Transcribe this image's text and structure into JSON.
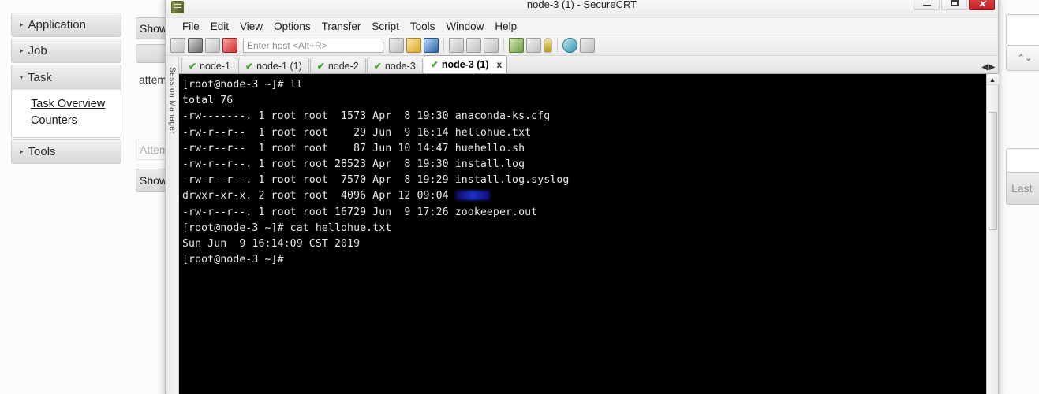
{
  "background_page": {
    "sidebar": {
      "sections": [
        {
          "label": "Application",
          "expanded": false,
          "arrow": "▸"
        },
        {
          "label": "Job",
          "expanded": false,
          "arrow": "▸"
        },
        {
          "label": "Task",
          "expanded": true,
          "arrow": "▾",
          "links": [
            "Task Overview",
            "Counters"
          ]
        },
        {
          "label": "Tools",
          "expanded": false,
          "arrow": "▸"
        }
      ]
    },
    "clipped_left_widgets": [
      {
        "label": "Show",
        "kind": "button"
      },
      {
        "label": "",
        "kind": "button"
      },
      {
        "label": "attem",
        "kind": "text"
      },
      {
        "label": "Attem",
        "kind": "ghost"
      },
      {
        "label": "Show",
        "kind": "button"
      }
    ],
    "clipped_right_widgets": [
      {
        "label": "",
        "kind": "input"
      },
      {
        "label": "⌃⌄",
        "kind": "spinner"
      },
      {
        "label": "",
        "kind": "input"
      },
      {
        "label": "Last",
        "kind": "button"
      }
    ]
  },
  "securecrt": {
    "title": "node-3 (1) - SecureCRT",
    "app_icon": "securecrt-icon",
    "window_controls": {
      "minimize": "–",
      "maximize": "❑",
      "close": "✕"
    },
    "menu": [
      "File",
      "Edit",
      "View",
      "Options",
      "Transfer",
      "Script",
      "Tools",
      "Window",
      "Help"
    ],
    "toolbar": {
      "host_input_placeholder": "Enter host <Alt+R>",
      "host_input_value": "",
      "icons": [
        "session-manager-icon",
        "connect-icon",
        "connect-sftp-icon",
        "disconnect-icon",
        "copy-icon",
        "paste-icon",
        "find-icon",
        "print-icon",
        "log-session-icon",
        "print-selection-icon",
        "new-window-icon",
        "options-icon",
        "pin-icon",
        "help-icon",
        "chart-icon"
      ]
    },
    "session_manager_tab": "Session Manager",
    "tabs": [
      {
        "label": "node-1",
        "active": false,
        "status": "✔"
      },
      {
        "label": "node-1 (1)",
        "active": false,
        "status": "✔"
      },
      {
        "label": "node-2",
        "active": false,
        "status": "✔"
      },
      {
        "label": "node-3",
        "active": false,
        "status": "✔"
      },
      {
        "label": "node-3 (1)",
        "active": true,
        "status": "✔",
        "close": "x"
      }
    ],
    "tab_nav": {
      "prev": "◀",
      "next": "▶"
    },
    "scrollbar": {
      "up_arrow": "▲"
    },
    "terminal": {
      "background": "#000000",
      "foreground": "#e8e8e8",
      "dir_color": "#2030c8",
      "lines": [
        "[root@node-3 ~]# ll",
        "total 76",
        "-rw-------. 1 root root  1573 Apr  8 19:30 anaconda-ks.cfg",
        "-rw-r--r--  1 root root    29 Jun  9 16:14 hellohue.txt",
        "-rw-r--r--  1 root root    87 Jun 10 14:47 huehello.sh",
        "-rw-r--r--. 1 root root 28523 Apr  8 19:30 install.log",
        "-rw-r--r--. 1 root root  7570 Apr  8 19:29 install.log.syslog",
        "drwxr-xr-x. 2 root root  4096 Apr 12 09:04 ",
        "-rw-r--r--. 1 root root 16729 Jun  9 17:26 zookeeper.out",
        "[root@node-3 ~]# cat hellohue.txt",
        "Sun Jun  9 16:14:09 CST 2019",
        "[root@node-3 ~]# "
      ],
      "redacted_dir_line_index": 7,
      "redacted_dir_label": "redacted-directory-name"
    }
  }
}
